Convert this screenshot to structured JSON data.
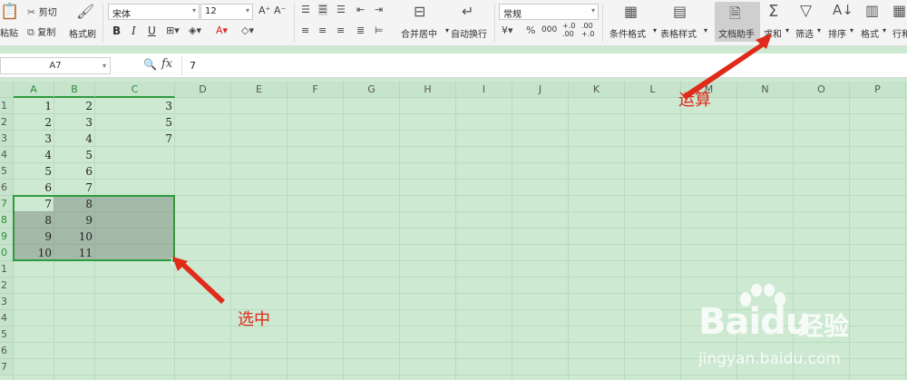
{
  "toolbar": {
    "paste": "粘贴",
    "cut": "剪切",
    "copy": "复制",
    "format_painter": "格式刷",
    "font_name": "宋体",
    "font_size": "12",
    "bold": "B",
    "italic": "I",
    "underline": "U",
    "merge_center": "合并居中",
    "wrap_text": "自动换行",
    "number_format": "常规",
    "percent": "%",
    "thousands": "000",
    "inc_decimal": "+.0 .00",
    "dec_decimal": ".00 +.0",
    "conditional_format": "条件格式",
    "table_style": "表格样式",
    "doc_assistant": "文档助手",
    "sum": "求和",
    "filter": "筛选",
    "sort": "排序",
    "format": "格式",
    "rows_cols": "行和"
  },
  "formula_bar": {
    "name_box": "A7",
    "fx": "fx",
    "value": "7"
  },
  "grid": {
    "columns": [
      "A",
      "B",
      "C",
      "D",
      "E",
      "F",
      "G",
      "H",
      "I",
      "J",
      "K",
      "L",
      "M",
      "N",
      "O",
      "P"
    ],
    "rows": [
      "1",
      "2",
      "3",
      "4",
      "5",
      "6",
      "7",
      "8",
      "9",
      "10",
      "11",
      "12",
      "13",
      "14",
      "15",
      "16",
      "17"
    ],
    "row_labels_visible": [
      "1",
      "2",
      "3",
      "4",
      "5",
      "6",
      "7",
      "8",
      "9",
      "0",
      "1",
      "2",
      "3",
      "4",
      "5",
      "6",
      "7"
    ],
    "cells": [
      {
        "ref": "A1",
        "value": "1"
      },
      {
        "ref": "B1",
        "value": "2"
      },
      {
        "ref": "C1",
        "value": "3"
      },
      {
        "ref": "A2",
        "value": "2"
      },
      {
        "ref": "B2",
        "value": "3"
      },
      {
        "ref": "C2",
        "value": "5"
      },
      {
        "ref": "A3",
        "value": "3"
      },
      {
        "ref": "B3",
        "value": "4"
      },
      {
        "ref": "C3",
        "value": "7"
      },
      {
        "ref": "A4",
        "value": "4"
      },
      {
        "ref": "B4",
        "value": "5"
      },
      {
        "ref": "A5",
        "value": "5"
      },
      {
        "ref": "B5",
        "value": "6"
      },
      {
        "ref": "A6",
        "value": "6"
      },
      {
        "ref": "B6",
        "value": "7"
      },
      {
        "ref": "A7",
        "value": "7"
      },
      {
        "ref": "B7",
        "value": "8"
      },
      {
        "ref": "A8",
        "value": "8"
      },
      {
        "ref": "B8",
        "value": "9"
      },
      {
        "ref": "A9",
        "value": "9"
      },
      {
        "ref": "B9",
        "value": "10"
      },
      {
        "ref": "A10",
        "value": "10"
      },
      {
        "ref": "B10",
        "value": "11"
      }
    ],
    "selection": "A7:C10"
  },
  "annotations": {
    "compute": "运算",
    "select": "选中"
  },
  "watermark": {
    "brand": "Baidu",
    "brand_cn": "经验",
    "url": "jingyan.baidu.com"
  },
  "colors": {
    "sheet_bg": "#cde9d2",
    "selection_border": "#2f9a3d",
    "annotation": "#e02a1a"
  }
}
